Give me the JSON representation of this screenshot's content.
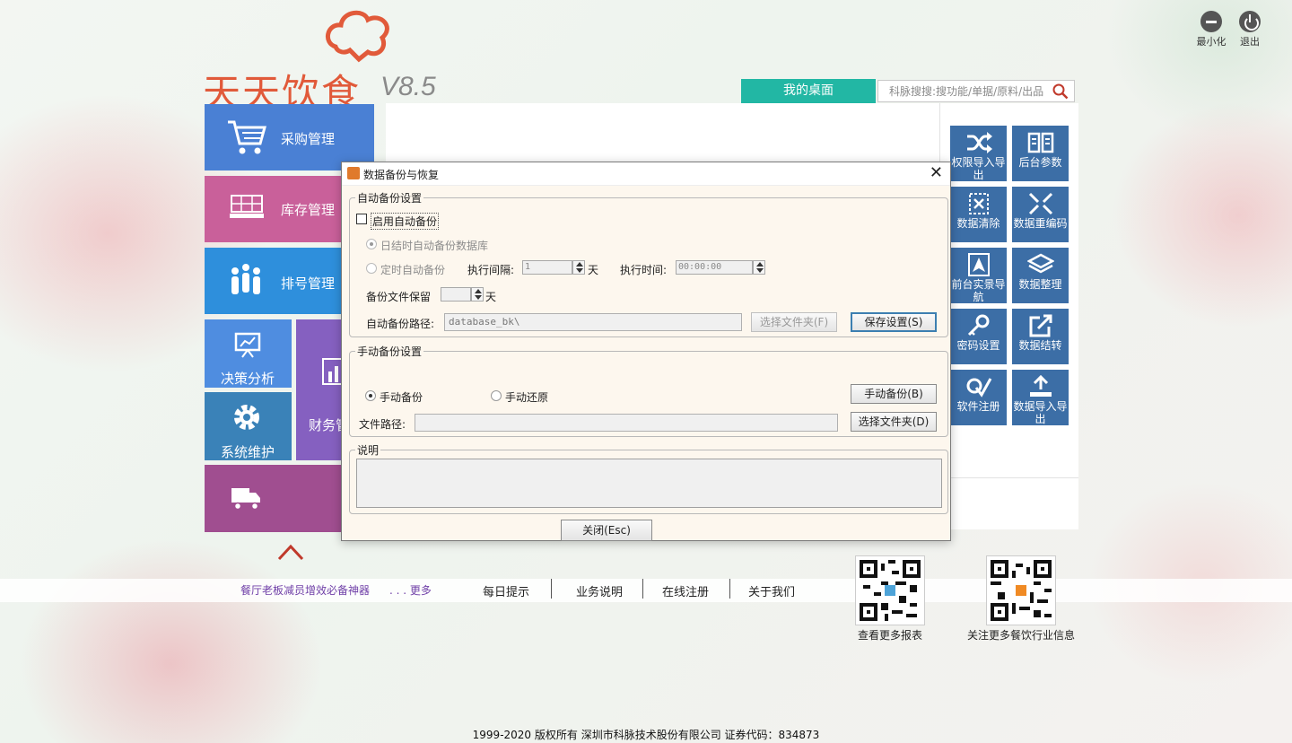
{
  "window": {
    "minimize_label": "最小化",
    "exit_label": "退出"
  },
  "logo": {
    "name": "天天饮食",
    "version": "V8.5"
  },
  "header": {
    "desktop_tab": "我的桌面",
    "search_placeholder": "科脉搜搜:搜功能/单据/原料/出品"
  },
  "tiles": {
    "purchase": "采购管理",
    "stock": "库存管理",
    "queue": "排号管理",
    "decision": "决策分析",
    "system": "系统维护",
    "finance": "财务管理"
  },
  "right_tiles": [
    {
      "label": "权限导入导出",
      "icon": "shuffle-icon"
    },
    {
      "label": "后台参数",
      "icon": "book-icon"
    },
    {
      "label": "数据清除",
      "icon": "clear-icon"
    },
    {
      "label": "数据重编码",
      "icon": "compress-icon"
    },
    {
      "label": "前台实景导航",
      "icon": "navigation-icon"
    },
    {
      "label": "数据整理",
      "icon": "layers-icon"
    },
    {
      "label": "密码设置",
      "icon": "key-icon"
    },
    {
      "label": "数据结转",
      "icon": "external-link-icon"
    },
    {
      "label": "软件注册",
      "icon": "register-icon"
    },
    {
      "label": "数据导入导出",
      "icon": "upload-icon"
    }
  ],
  "bottom": {
    "promo": "餐厅老板减员增效必备神器",
    "more": ". . . 更多",
    "links": [
      "每日提示",
      "业务说明",
      "在线注册",
      "关于我们"
    ],
    "qr1_caption": "查看更多报表",
    "qr2_caption": "关注更多餐饮行业信息",
    "copyright": "1999-2020  版权所有   深圳市科脉技术股份有限公司   证券代码：834873"
  },
  "dialog": {
    "title": "数据备份与恢复",
    "auto_group": "自动备份设置",
    "enable_auto": "启用自动备份",
    "opt_daily": "日结时自动备份数据库",
    "opt_timed": "定时自动备份",
    "interval_label": "执行间隔:",
    "interval_value": "1",
    "day_unit": "天",
    "time_label": "执行时间:",
    "time_value": "00:00:00",
    "keep_label": "备份文件保留",
    "keep_value": "",
    "path_label": "自动备份路径:",
    "path_value": "database_bk\\",
    "choose_folder_f": "选择文件夹(F)",
    "save_settings": "保存设置(S)",
    "manual_group": "手动备份设置",
    "manual_backup_opt": "手动备份",
    "manual_restore_opt": "手动还原",
    "manual_backup_btn": "手动备份(B)",
    "file_path_label": "文件路径:",
    "file_path_value": "",
    "choose_folder_d": "选择文件夹(D)",
    "desc_group": "说明",
    "close_btn": "关闭(Esc)"
  },
  "colors": {
    "brand": "#e15a3a",
    "desktop_tab": "#22b7a4",
    "right_tile": "#3c6ea6"
  }
}
